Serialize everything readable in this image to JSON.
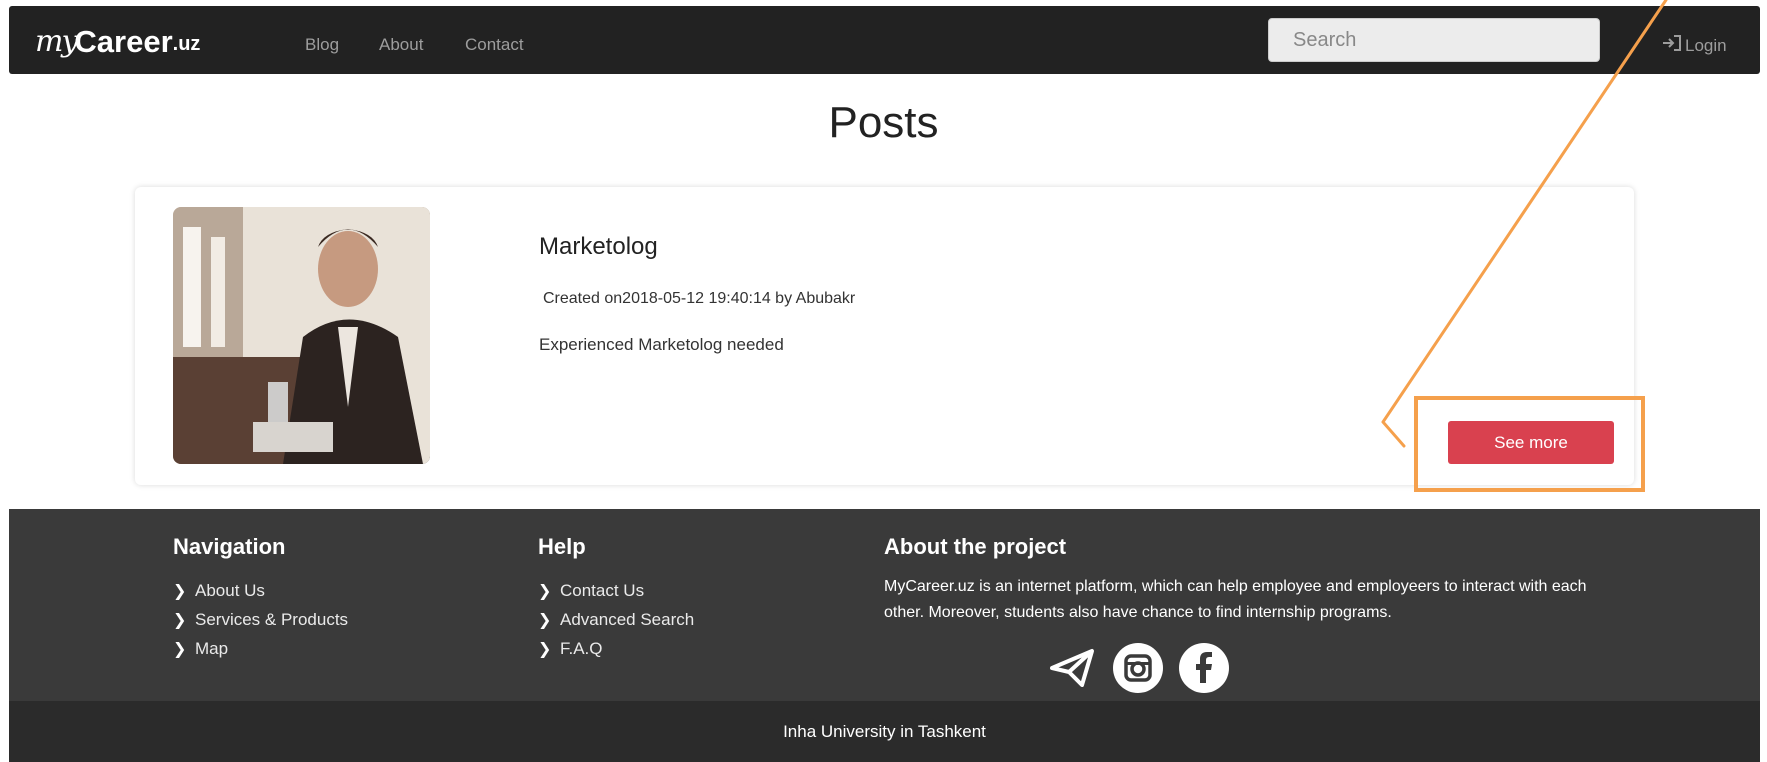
{
  "navbar": {
    "brand_script": "my",
    "brand_main": "Career",
    "brand_tld": ".uz",
    "links": [
      "Blog",
      "About",
      "Contact"
    ],
    "search_placeholder": "Search",
    "login_label": "Login"
  },
  "page_title": "Posts",
  "post": {
    "title": "Marketolog",
    "meta": "Created on2018-05-12 19:40:14 by Abubakr",
    "description": "Experienced Marketolog needed",
    "button_label": "See more"
  },
  "footer": {
    "navigation": {
      "heading": "Navigation",
      "items": [
        "About Us",
        "Services & Products",
        "Map"
      ]
    },
    "help": {
      "heading": "Help",
      "items": [
        "Contact Us",
        "Advanced Search",
        "F.A.Q"
      ]
    },
    "about": {
      "heading": "About the project",
      "text": "MyCareer.uz is an internet platform, which can help employee and employeers to interact with each other. Moreover, students also have chance to find internship programs."
    },
    "social_icons": [
      "telegram-icon",
      "instagram-icon",
      "facebook-icon"
    ],
    "bottom_text": "Inha University in Tashkent"
  },
  "colors": {
    "navbar_bg": "#222222",
    "button_red": "#d9414f",
    "annotation_orange": "#f5a04c",
    "footer_bg": "#3a3a3a",
    "bottom_bg": "#2b2b2b"
  }
}
